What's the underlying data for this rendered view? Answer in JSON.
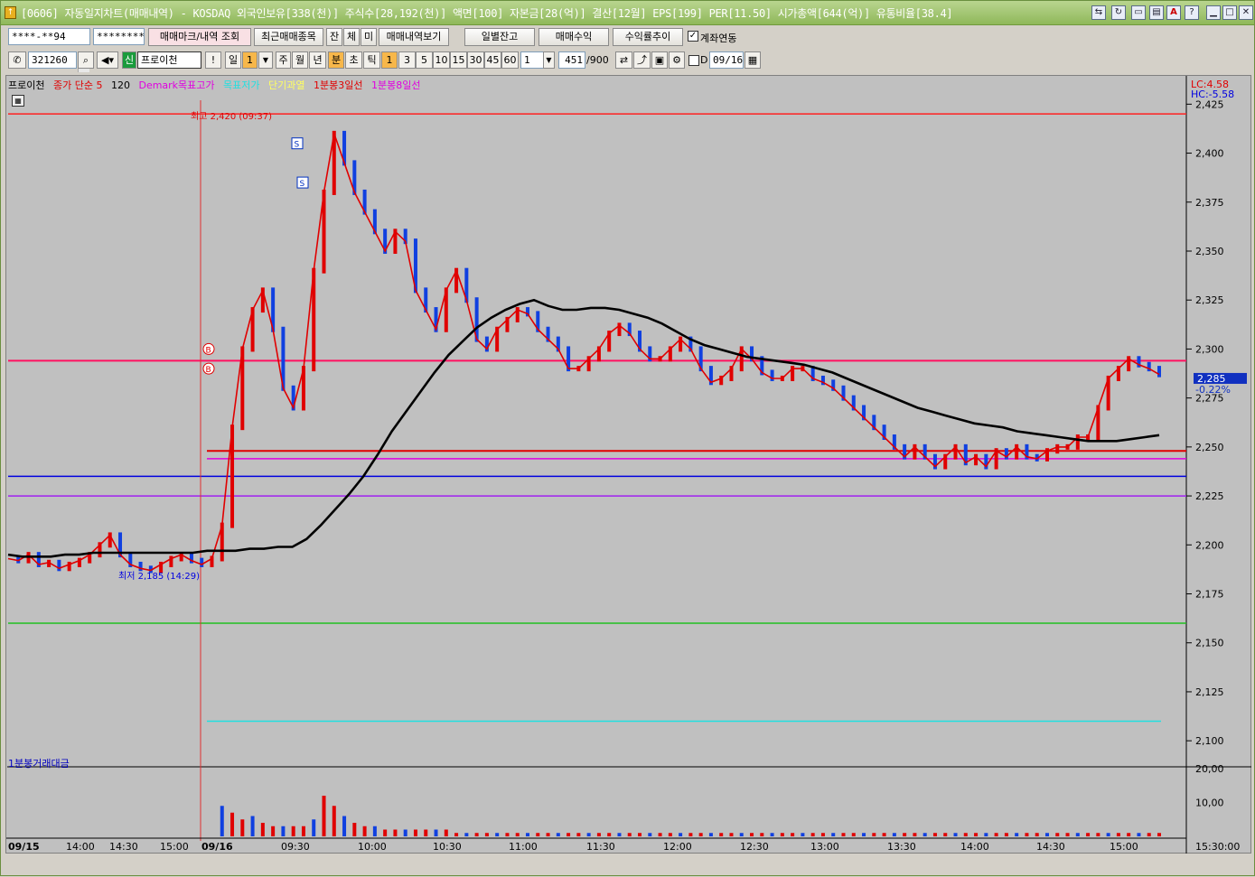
{
  "window": {
    "title": "[0606] 자동일지차트(매매내역) - KOSDAQ 외국인보유[338(천)] 주식수[28,192(천)] 액면[100] 자본금[28(억)] 결산[12월] EPS[199] PER[11.50] 시가총액[644(억)] 유통비율[38.4]"
  },
  "toolbar1": {
    "account": "****-**94",
    "password": "*********",
    "btn_mark": "매매마크/내역 조회",
    "btn_recent": "최근매매종목",
    "btn_jan": "잔",
    "btn_che": "체",
    "btn_mi": "미",
    "btn_view": "매매내역보기",
    "btn_daily": "일별잔고",
    "btn_profit": "매매수익",
    "btn_rate": "수익률추이",
    "chk_link": "계좌연동"
  },
  "toolbar2": {
    "code": "321260",
    "shin": "신",
    "name": "프로이천",
    "excl": "!",
    "day": "일",
    "day_val": "1",
    "week": "주",
    "month": "월",
    "year": "년",
    "minute": "분",
    "second": "초",
    "tick": "틱",
    "periods": [
      "1",
      "3",
      "5",
      "10",
      "15",
      "30",
      "45",
      "60"
    ],
    "count_sel": "1",
    "count": "451",
    "count_max": "/900",
    "d_label": "D",
    "date": "09/16"
  },
  "legend": {
    "name": "프로이천",
    "ma": "종가 단순 5",
    "ma_n": "120",
    "demark": "Demark목표고가",
    "target": "목표저가",
    "short": "단기과열",
    "line3": "1분봉3일선",
    "line8": "1분봉8일선",
    "lc": "LC:4.58",
    "hc": "HC:-5.58"
  },
  "annotations": {
    "high": "최고 2,420 (09:37)",
    "low": "최저 2,185 (14:29)",
    "buy": "B",
    "sell": "S"
  },
  "price_axis": [
    "2,425",
    "2,400",
    "2,375",
    "2,350",
    "2,325",
    "2,300",
    "2,275",
    "2,250",
    "2,225",
    "2,200",
    "2,175",
    "2,150",
    "2,125",
    "2,100"
  ],
  "current_price": "2,285",
  "current_change": "-0.22%",
  "volume_panel": {
    "label": "1분봉거래대금",
    "axis": [
      "20,00",
      "10,00"
    ]
  },
  "time_axis": [
    "09/15",
    "14:00",
    "14:30",
    "15:00",
    "09/16",
    "09:30",
    "10:00",
    "10:30",
    "11:00",
    "11:30",
    "12:00",
    "12:30",
    "13:00",
    "13:30",
    "14:00",
    "14:30",
    "15:00"
  ],
  "time_axis_end": "15:30:00",
  "chart_data": {
    "type": "line",
    "title": "",
    "y_range": [
      2095,
      2427
    ],
    "price_close": [
      2193,
      2192,
      2195,
      2190,
      2191,
      2188,
      2190,
      2192,
      2195,
      2200,
      2205,
      2195,
      2190,
      2188,
      2187,
      2190,
      2193,
      2195,
      2192,
      2190,
      2193,
      2210,
      2260,
      2300,
      2320,
      2330,
      2310,
      2280,
      2270,
      2290,
      2340,
      2380,
      2410,
      2395,
      2380,
      2370,
      2360,
      2350,
      2360,
      2355,
      2330,
      2320,
      2310,
      2330,
      2340,
      2325,
      2305,
      2300,
      2310,
      2315,
      2320,
      2318,
      2310,
      2305,
      2300,
      2290,
      2290,
      2295,
      2300,
      2308,
      2312,
      2308,
      2300,
      2295,
      2295,
      2300,
      2305,
      2300,
      2290,
      2283,
      2285,
      2290,
      2300,
      2295,
      2288,
      2285,
      2285,
      2290,
      2290,
      2285,
      2283,
      2280,
      2275,
      2270,
      2265,
      2260,
      2255,
      2250,
      2245,
      2250,
      2245,
      2240,
      2245,
      2250,
      2242,
      2245,
      2240,
      2248,
      2245,
      2250,
      2245,
      2244,
      2248,
      2250,
      2250,
      2255,
      2255,
      2270,
      2285,
      2290,
      2295,
      2292,
      2290,
      2287
    ],
    "ma120": [
      2195,
      2194,
      2194,
      2194,
      2195,
      2195,
      2196,
      2196,
      2196,
      2196,
      2196,
      2196,
      2196,
      2196,
      2197,
      2197,
      2197,
      2198,
      2198,
      2199,
      2199,
      2203,
      2210,
      2218,
      2226,
      2235,
      2246,
      2258,
      2268,
      2278,
      2288,
      2297,
      2304,
      2311,
      2316,
      2320,
      2323,
      2325,
      2322,
      2320,
      2320,
      2321,
      2321,
      2320,
      2318,
      2316,
      2313,
      2309,
      2305,
      2302,
      2300,
      2298,
      2296,
      2295,
      2294,
      2293,
      2292,
      2290,
      2288,
      2285,
      2282,
      2279,
      2276,
      2273,
      2270,
      2268,
      2266,
      2264,
      2262,
      2261,
      2260,
      2258,
      2257,
      2256,
      2255,
      2254,
      2253,
      2253,
      2253,
      2254,
      2255,
      2256
    ],
    "series_names": [],
    "volume": [
      0,
      0,
      0,
      0,
      0,
      0,
      0,
      0,
      0,
      0,
      0,
      0,
      0,
      0,
      0,
      0,
      0,
      0,
      0,
      0,
      0,
      9,
      7,
      5,
      6,
      4,
      3,
      3,
      3,
      3,
      5,
      12,
      9,
      6,
      4,
      3,
      3,
      2,
      2,
      2,
      2,
      2,
      2,
      2,
      1,
      1,
      1,
      1,
      1,
      1,
      1,
      1,
      1,
      1,
      1,
      1,
      1,
      1,
      1,
      1,
      1,
      1,
      1,
      1,
      1,
      1,
      1,
      1,
      1,
      1,
      1,
      1,
      1,
      1,
      1,
      1,
      1,
      1,
      1,
      1,
      1,
      1,
      1,
      1,
      1,
      1,
      1,
      1,
      1,
      1,
      1,
      1,
      1,
      1,
      1,
      1,
      1,
      1,
      1,
      1,
      1,
      1,
      1,
      1,
      1,
      1,
      1,
      1,
      1,
      1,
      1,
      1,
      1,
      1
    ],
    "h_levels": [
      {
        "value": 2420,
        "color": "#ff2020"
      },
      {
        "value": 2294,
        "color": "#ff1060"
      },
      {
        "value": 2248,
        "color": "#e00000"
      },
      {
        "value": 2244,
        "color": "#e000e0"
      },
      {
        "value": 2235,
        "color": "#0000e0"
      },
      {
        "value": 2225,
        "color": "#a020f0"
      },
      {
        "value": 2160,
        "color": "#20c020"
      },
      {
        "value": 2110,
        "color": "#20e0e0"
      }
    ]
  }
}
